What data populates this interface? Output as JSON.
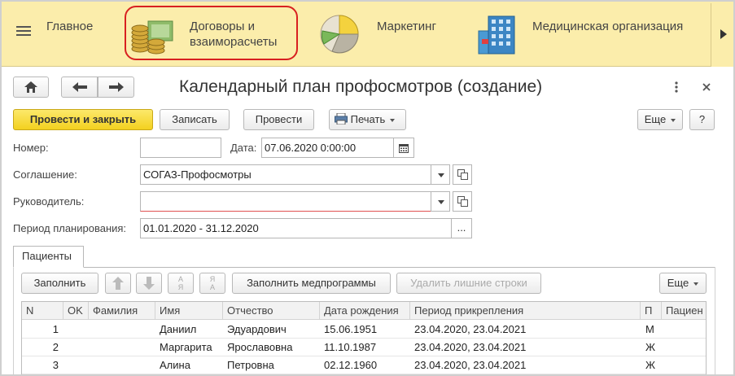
{
  "sections": {
    "main": "Главное",
    "contracts_line1": "Договоры и",
    "contracts_line2": "взаиморасчеты",
    "marketing": "Маркетинг",
    "medorg": "Медицинская организация"
  },
  "window": {
    "title": "Календарный план профосмотров (создание)"
  },
  "toolbar": {
    "post_close": "Провести и закрыть",
    "write": "Записать",
    "post": "Провести",
    "print": "Печать",
    "more": "Еще",
    "help": "?"
  },
  "form": {
    "number_label": "Номер:",
    "number_value": "",
    "date_label": "Дата:",
    "date_value": "07.06.2020  0:00:00",
    "agreement_label": "Соглашение:",
    "agreement_value": "СОГАЗ-Профосмотры",
    "manager_label": "Руководитель:",
    "manager_value": "",
    "period_label": "Период планирования:",
    "period_value": "01.01.2020 - 31.12.2020",
    "period_btn": "..."
  },
  "tab": {
    "label": "Пациенты"
  },
  "tabletoolbar": {
    "fill": "Заполнить",
    "sort_asc": "А\nЯ",
    "sort_desc": "Я\nА",
    "fill_programs": "Заполнить медпрограммы",
    "delete_extra": "Удалить лишние строки",
    "more": "Еще"
  },
  "table": {
    "headers": [
      "N",
      "OK",
      "Фамилия",
      "Имя",
      "Отчество",
      "Дата рождения",
      "Период прикрепления",
      "П",
      "Пациен"
    ],
    "rows": [
      {
        "n": "1",
        "ok": "",
        "lastname": "",
        "name": "Даниил",
        "patronymic": "Эдуардович",
        "birth": "15.06.1951",
        "period": "23.04.2020, 23.04.2021",
        "sex": "М",
        "patient": ""
      },
      {
        "n": "2",
        "ok": "",
        "lastname": "",
        "name": "Маргарита",
        "patronymic": "Ярославовна",
        "birth": "11.10.1987",
        "period": "23.04.2020, 23.04.2021",
        "sex": "Ж",
        "patient": ""
      },
      {
        "n": "3",
        "ok": "",
        "lastname": "",
        "name": "Алина",
        "patronymic": "Петровна",
        "birth": "02.12.1960",
        "period": "23.04.2020, 23.04.2021",
        "sex": "Ж",
        "patient": ""
      }
    ]
  },
  "icons": {
    "menu": "hamburger-menu-icon",
    "coins": "coins-money-icon",
    "pie": "pie-chart-icon",
    "building": "building-icon",
    "home": "home-icon",
    "back": "arrow-left-icon",
    "forward": "arrow-right-icon",
    "kebab": "kebab-menu-icon",
    "close": "close-icon",
    "printer": "printer-icon",
    "calendar": "calendar-icon",
    "arrow_up": "arrow-up-icon",
    "arrow_down": "arrow-down-icon"
  },
  "colors": {
    "top_panel": "#fbedab",
    "primary_button": "#f3d11f",
    "highlight": "#d82020",
    "required_underline": "#e05050"
  }
}
